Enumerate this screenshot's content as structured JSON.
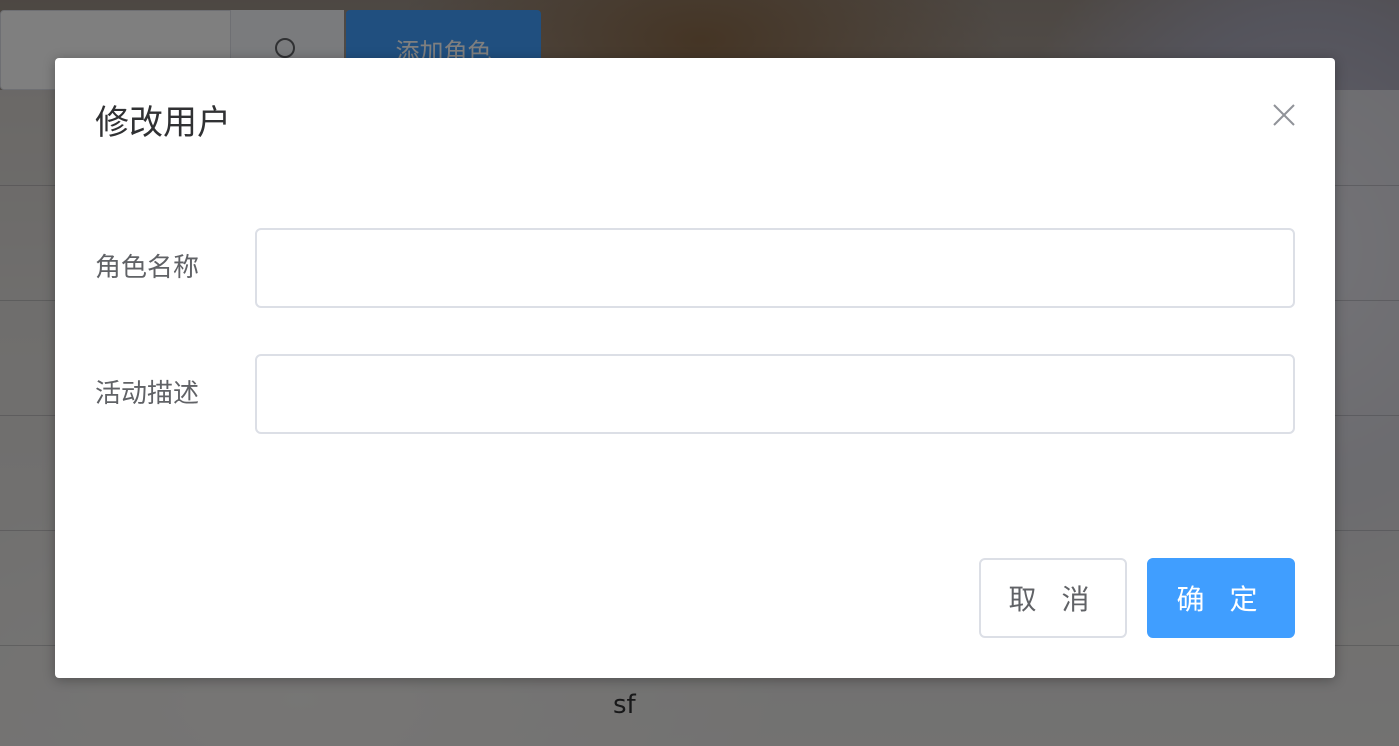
{
  "background": {
    "add_role_label": "添加角色",
    "table_cell_text": "sf"
  },
  "dialog": {
    "title": "修改用户",
    "fields": [
      {
        "label": "角色名称",
        "value": "",
        "placeholder": ""
      },
      {
        "label": "活动描述",
        "value": "",
        "placeholder": ""
      }
    ],
    "cancel_label": "取 消",
    "confirm_label": "确 定"
  },
  "colors": {
    "primary": "#409eff",
    "border": "#dcdfe6",
    "text_primary": "#303133",
    "text_regular": "#606266"
  },
  "icons": {
    "close": "close-icon",
    "search": "search-icon"
  }
}
